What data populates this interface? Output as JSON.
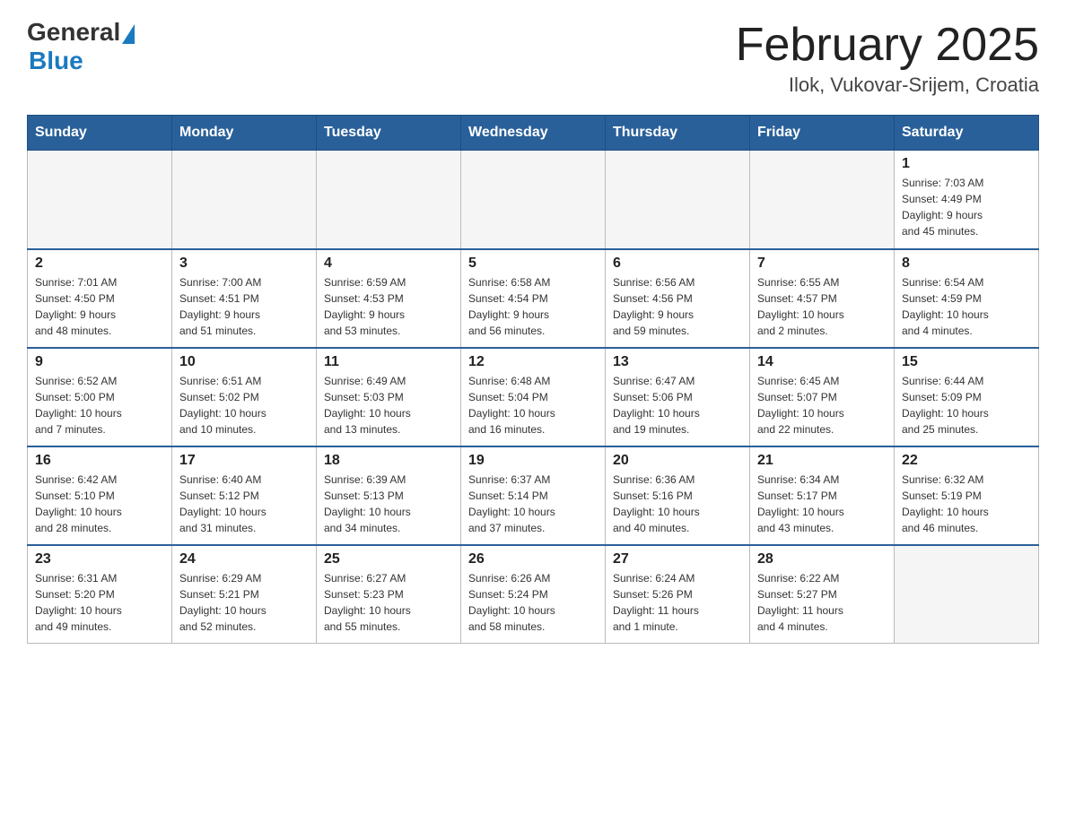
{
  "header": {
    "logo_general": "General",
    "logo_blue": "Blue",
    "month_title": "February 2025",
    "location": "Ilok, Vukovar-Srijem, Croatia"
  },
  "weekdays": [
    "Sunday",
    "Monday",
    "Tuesday",
    "Wednesday",
    "Thursday",
    "Friday",
    "Saturday"
  ],
  "weeks": [
    [
      {
        "day": "",
        "info": ""
      },
      {
        "day": "",
        "info": ""
      },
      {
        "day": "",
        "info": ""
      },
      {
        "day": "",
        "info": ""
      },
      {
        "day": "",
        "info": ""
      },
      {
        "day": "",
        "info": ""
      },
      {
        "day": "1",
        "info": "Sunrise: 7:03 AM\nSunset: 4:49 PM\nDaylight: 9 hours\nand 45 minutes."
      }
    ],
    [
      {
        "day": "2",
        "info": "Sunrise: 7:01 AM\nSunset: 4:50 PM\nDaylight: 9 hours\nand 48 minutes."
      },
      {
        "day": "3",
        "info": "Sunrise: 7:00 AM\nSunset: 4:51 PM\nDaylight: 9 hours\nand 51 minutes."
      },
      {
        "day": "4",
        "info": "Sunrise: 6:59 AM\nSunset: 4:53 PM\nDaylight: 9 hours\nand 53 minutes."
      },
      {
        "day": "5",
        "info": "Sunrise: 6:58 AM\nSunset: 4:54 PM\nDaylight: 9 hours\nand 56 minutes."
      },
      {
        "day": "6",
        "info": "Sunrise: 6:56 AM\nSunset: 4:56 PM\nDaylight: 9 hours\nand 59 minutes."
      },
      {
        "day": "7",
        "info": "Sunrise: 6:55 AM\nSunset: 4:57 PM\nDaylight: 10 hours\nand 2 minutes."
      },
      {
        "day": "8",
        "info": "Sunrise: 6:54 AM\nSunset: 4:59 PM\nDaylight: 10 hours\nand 4 minutes."
      }
    ],
    [
      {
        "day": "9",
        "info": "Sunrise: 6:52 AM\nSunset: 5:00 PM\nDaylight: 10 hours\nand 7 minutes."
      },
      {
        "day": "10",
        "info": "Sunrise: 6:51 AM\nSunset: 5:02 PM\nDaylight: 10 hours\nand 10 minutes."
      },
      {
        "day": "11",
        "info": "Sunrise: 6:49 AM\nSunset: 5:03 PM\nDaylight: 10 hours\nand 13 minutes."
      },
      {
        "day": "12",
        "info": "Sunrise: 6:48 AM\nSunset: 5:04 PM\nDaylight: 10 hours\nand 16 minutes."
      },
      {
        "day": "13",
        "info": "Sunrise: 6:47 AM\nSunset: 5:06 PM\nDaylight: 10 hours\nand 19 minutes."
      },
      {
        "day": "14",
        "info": "Sunrise: 6:45 AM\nSunset: 5:07 PM\nDaylight: 10 hours\nand 22 minutes."
      },
      {
        "day": "15",
        "info": "Sunrise: 6:44 AM\nSunset: 5:09 PM\nDaylight: 10 hours\nand 25 minutes."
      }
    ],
    [
      {
        "day": "16",
        "info": "Sunrise: 6:42 AM\nSunset: 5:10 PM\nDaylight: 10 hours\nand 28 minutes."
      },
      {
        "day": "17",
        "info": "Sunrise: 6:40 AM\nSunset: 5:12 PM\nDaylight: 10 hours\nand 31 minutes."
      },
      {
        "day": "18",
        "info": "Sunrise: 6:39 AM\nSunset: 5:13 PM\nDaylight: 10 hours\nand 34 minutes."
      },
      {
        "day": "19",
        "info": "Sunrise: 6:37 AM\nSunset: 5:14 PM\nDaylight: 10 hours\nand 37 minutes."
      },
      {
        "day": "20",
        "info": "Sunrise: 6:36 AM\nSunset: 5:16 PM\nDaylight: 10 hours\nand 40 minutes."
      },
      {
        "day": "21",
        "info": "Sunrise: 6:34 AM\nSunset: 5:17 PM\nDaylight: 10 hours\nand 43 minutes."
      },
      {
        "day": "22",
        "info": "Sunrise: 6:32 AM\nSunset: 5:19 PM\nDaylight: 10 hours\nand 46 minutes."
      }
    ],
    [
      {
        "day": "23",
        "info": "Sunrise: 6:31 AM\nSunset: 5:20 PM\nDaylight: 10 hours\nand 49 minutes."
      },
      {
        "day": "24",
        "info": "Sunrise: 6:29 AM\nSunset: 5:21 PM\nDaylight: 10 hours\nand 52 minutes."
      },
      {
        "day": "25",
        "info": "Sunrise: 6:27 AM\nSunset: 5:23 PM\nDaylight: 10 hours\nand 55 minutes."
      },
      {
        "day": "26",
        "info": "Sunrise: 6:26 AM\nSunset: 5:24 PM\nDaylight: 10 hours\nand 58 minutes."
      },
      {
        "day": "27",
        "info": "Sunrise: 6:24 AM\nSunset: 5:26 PM\nDaylight: 11 hours\nand 1 minute."
      },
      {
        "day": "28",
        "info": "Sunrise: 6:22 AM\nSunset: 5:27 PM\nDaylight: 11 hours\nand 4 minutes."
      },
      {
        "day": "",
        "info": ""
      }
    ]
  ]
}
